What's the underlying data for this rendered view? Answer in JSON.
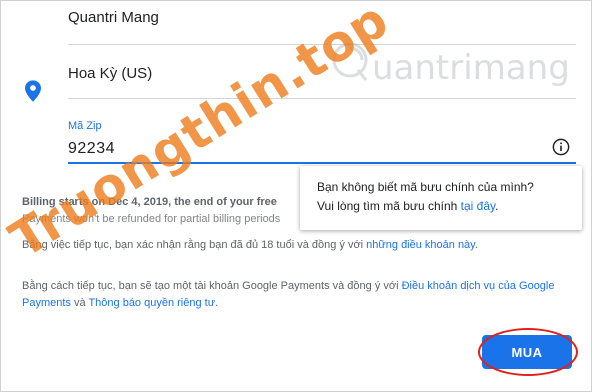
{
  "form": {
    "name_value": "Quantri Mang",
    "country_value": "Hoa Kỳ (US)",
    "zip_label": "Mã Zip",
    "zip_value": "92234"
  },
  "tooltip": {
    "line1": "Bạn không biết mã bưu chính của mình?",
    "line2_prefix": "Vui lòng tìm mã bưu chính ",
    "line2_link": "tại đây",
    "line2_suffix": "."
  },
  "billing": {
    "start_text": "Billing starts on Dec 4, 2019, the end of your free",
    "refund_text": "Payments won't be refunded for partial billing periods"
  },
  "agreement": {
    "age_prefix": "Bằng việc tiếp tục, bạn xác nhận rằng bạn đã đủ 18 tuổi và đồng ý với ",
    "age_link": "những điều khoản này",
    "age_suffix": ".",
    "payments_prefix": "Bằng cách tiếp tục, bạn sẽ tạo một tài khoản Google Payments và đồng ý với ",
    "tos_link": "Điều khoản dịch vụ của Google Payments",
    "and_text": " và ",
    "privacy_link": "Thông báo quyền riêng tư",
    "payments_suffix": "."
  },
  "buttons": {
    "buy_label": "MUA"
  },
  "watermarks": {
    "logo_text": "uantrimang",
    "diagonal_text": "Truongthin.top"
  },
  "colors": {
    "accent": "#1a73e8",
    "highlight": "#e0201b",
    "watermark": "#ee7d1b"
  },
  "icons": {
    "location": "location-pin-icon",
    "info": "info-circle-icon"
  }
}
